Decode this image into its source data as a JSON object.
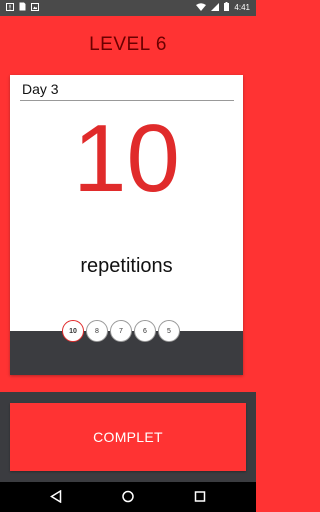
{
  "status_bar": {
    "time": "4:41",
    "icons_left": [
      "alert-icon",
      "sim-icon",
      "media-icon"
    ],
    "icons_right": [
      "wifi-icon",
      "signal-icon",
      "battery-icon"
    ]
  },
  "header": {
    "title": "LEVEL 6"
  },
  "card": {
    "day_label": "Day 3",
    "reps_count": "10",
    "reps_label": "repetitions"
  },
  "sets": [
    {
      "value": "10",
      "active": true
    },
    {
      "value": "8",
      "active": false
    },
    {
      "value": "7",
      "active": false
    },
    {
      "value": "6",
      "active": false
    },
    {
      "value": "5",
      "active": false
    }
  ],
  "complete_button": {
    "label": "COMPLET"
  },
  "nav_bar": {
    "icons": [
      "back-icon",
      "home-icon",
      "recents-icon"
    ]
  },
  "colors": {
    "accent": "#ff3333",
    "dark": "#3b3c40",
    "number": "#e02b2b"
  }
}
